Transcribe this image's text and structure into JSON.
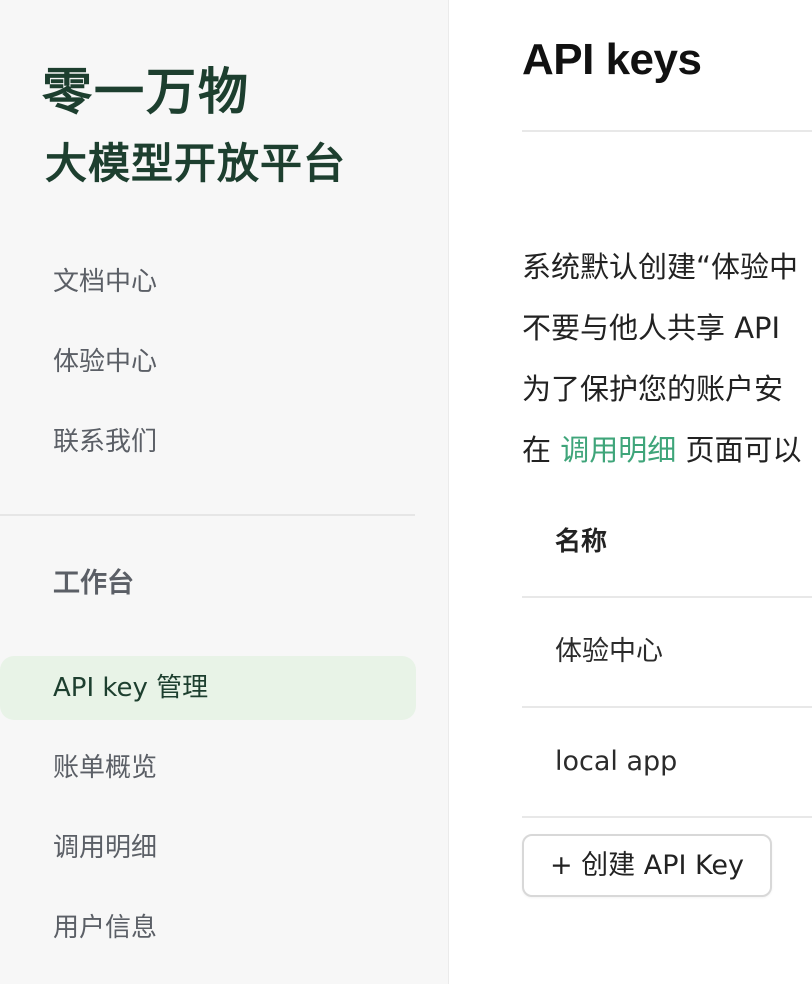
{
  "sidebar": {
    "brand_line1": "零一万物",
    "brand_line2": "大模型开放平台",
    "top_items": [
      "文档中心",
      "体验中心",
      "联系我们"
    ],
    "section_title": "工作台",
    "work_items": [
      "API key 管理",
      "账单概览",
      "调用明细",
      "用户信息"
    ],
    "active_item": "API key 管理",
    "colors": {
      "brand": "#1d3f2f",
      "active_bg": "#e8f3e7",
      "link": "#3fa57a"
    }
  },
  "main": {
    "title": "API keys",
    "paragraphs": {
      "p1": "系统默认创建“体验中",
      "p2": "不要与他人共享 API",
      "p3": "为了保护您的账户安",
      "p4_prefix": "在 ",
      "p4_link": "调用明细",
      "p4_suffix": " 页面可以"
    },
    "table": {
      "column_name": "名称",
      "rows": [
        "体验中心",
        "local app"
      ]
    },
    "create_button": "+ 创建 API Key"
  }
}
